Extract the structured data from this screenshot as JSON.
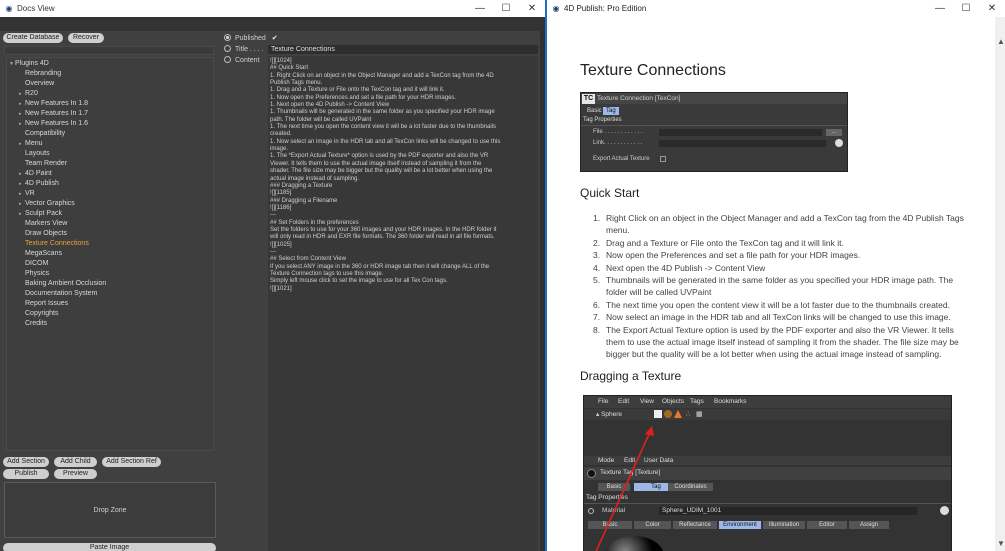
{
  "left_window": {
    "title": "Docs View",
    "toolbar": {
      "create_db": "Create Database",
      "recover": "Recover"
    },
    "tree": {
      "root": "Plugins 4D",
      "items": [
        {
          "label": "Rebranding",
          "arrow": false
        },
        {
          "label": "Overview",
          "arrow": false
        },
        {
          "label": "R20",
          "arrow": true
        },
        {
          "label": "New Features In 1.8",
          "arrow": true
        },
        {
          "label": "New Features In 1.7",
          "arrow": true
        },
        {
          "label": "New Features In 1.6",
          "arrow": true
        },
        {
          "label": "Compatibility",
          "arrow": false
        },
        {
          "label": "Menu",
          "arrow": true
        },
        {
          "label": "Layouts",
          "arrow": false
        },
        {
          "label": "Team Render",
          "arrow": false
        },
        {
          "label": "4D Paint",
          "arrow": true
        },
        {
          "label": "4D Publish",
          "arrow": true
        },
        {
          "label": "VR",
          "arrow": true
        },
        {
          "label": "Vector Graphics",
          "arrow": true
        },
        {
          "label": "Sculpt Pack",
          "arrow": true
        },
        {
          "label": "Markers View",
          "arrow": false
        },
        {
          "label": "Draw Objects",
          "arrow": false
        },
        {
          "label": "Texture Connections",
          "arrow": false,
          "selected": true
        },
        {
          "label": "MegaScans",
          "arrow": false
        },
        {
          "label": "DICOM",
          "arrow": false
        },
        {
          "label": "Physics",
          "arrow": false
        },
        {
          "label": "Baking Ambient Occlusion",
          "arrow": false
        },
        {
          "label": "Documentation System",
          "arrow": false
        },
        {
          "label": "Report Issues",
          "arrow": false
        },
        {
          "label": "Copyrights",
          "arrow": false
        },
        {
          "label": "Credits",
          "arrow": false
        }
      ]
    },
    "buttons": {
      "add_section": "Add Section",
      "add_child": "Add Child",
      "add_section_ref": "Add Section Ref",
      "publish": "Publish",
      "preview": "Preview"
    },
    "drop_zone": "Drop Zone",
    "paste_image": "Paste Image",
    "props": {
      "published_label": "Published",
      "published_check": "✔",
      "title_label": "Title . . . .",
      "title_value": "Texture Connections",
      "content_label": "Content"
    },
    "content_lines": [
      "![][1024]",
      "",
      "## Quick Start",
      "",
      "1. Right Click on an object in the Object Manager and add a TexCon tag from the 4D",
      "Publish Tags menu.",
      "1. Drag and a Texture or File onto the TexCon tag and it will link it.",
      "1. Now open the Preferences and set a file path for your HDR images.",
      "1. Next open the 4D Publish -> Content View",
      "1. Thumbnails will be generated in the same folder as you specified your HDR image",
      "path. The folder will be called UVPaint",
      "1. The next time you open the content view it will be a lot faster due to the thumbnails",
      "created.",
      "1. Now select an image in the HDR tab and all TexCon links will be changed to use this",
      "image.",
      "1. The *Export Actual Texture* option is used by the PDF exporter and also the VR",
      "Viewer. It tells them to use the actual image itself instead of sampling it from the",
      "shader. The file size may be bigger but the quality will be a lot better when using the",
      "actual image instead of sampling.",
      "",
      "",
      "### Dragging a Texture",
      "![][1185]",
      "",
      "### Dragging a Filename",
      "![][1186]",
      "",
      "",
      "---",
      "",
      "",
      "## Set Folders in the preferences",
      "Set the folders to use for your 360 images and your HDR images. In the HDR folder it",
      "will only read in HDR and EXR file formats. The 360 folder will read in all file formats.",
      "",
      "![][1025]",
      "",
      "---",
      "",
      "## Select from Content View",
      "",
      "If you select ANY image in the 360 or HDR image tab then it will change ALL of the",
      "Texture Connection tags to use this image.",
      "",
      "Simply left mouse click to set the image to use for all Tex Con tags.",
      "",
      "![][1021]"
    ]
  },
  "right_window": {
    "title": "4D Publish: Pro Edition",
    "h1": "Texture Connections",
    "panel1": {
      "tc": "TC",
      "header": "Texture Connection [TexCon]",
      "tab_basic": "Basic",
      "tab_tag": "Tag",
      "section": "Tag Properties",
      "file_label": "File . . . . . . . . . . . .",
      "link_label": "Link. . . . . . . . . . . .",
      "export_label": "Export Actual Texture"
    },
    "quick_start": "Quick Start",
    "steps": [
      [
        "1.",
        "Right Click on an object in the Object Manager and add a TexCon tag from the 4D Publish Tags"
      ],
      [
        "",
        "menu."
      ],
      [
        "2.",
        "Drag and a Texture or File onto the TexCon tag and it will link it."
      ],
      [
        "3.",
        "Now open the Preferences and set a file path for your HDR images."
      ],
      [
        "4.",
        "Next open the 4D Publish -> Content View"
      ],
      [
        "5.",
        "Thumbnails will be generated in the same folder as you specified your HDR image path. The"
      ],
      [
        "",
        "folder will be called UVPaint"
      ],
      [
        "6.",
        "The next time you open the content view it will be a lot faster due to the thumbnails created."
      ],
      [
        "7.",
        "Now select an image in the HDR tab and all TexCon links will be changed to use this image."
      ],
      [
        "8.",
        "The Export Actual Texture option is used by the PDF exporter and also the VR Viewer. It tells"
      ],
      [
        "",
        "them to use the actual image itself instead of sampling it from the shader. The file size may be"
      ],
      [
        "",
        "bigger but the quality will be a lot better when using the actual image instead of sampling."
      ]
    ],
    "dragging": "Dragging a Texture",
    "panel2": {
      "menus": [
        "File",
        "Edit",
        "View",
        "Objects",
        "Tags",
        "Bookmarks"
      ],
      "object": "Sphere",
      "attr_menus": [
        "Mode",
        "Edit",
        "User Data"
      ],
      "tag_title": "Texture Tag [Texture]",
      "tabs": [
        "Basic",
        "Tag",
        "Coordinates"
      ],
      "section": "Tag Properties",
      "material_label": "Material",
      "material_value": "Sphere_UDIM_1001",
      "mat_tabs": [
        "Basic",
        "Color",
        "Reflectance",
        "Environment",
        "Illumination",
        "Editor",
        "Assign"
      ]
    }
  },
  "colors": {
    "accent": "#e8a33c",
    "tab_highlight": "#9db8e8",
    "drag_arrow": "#e02020",
    "window_border": "#1e6fc7"
  }
}
